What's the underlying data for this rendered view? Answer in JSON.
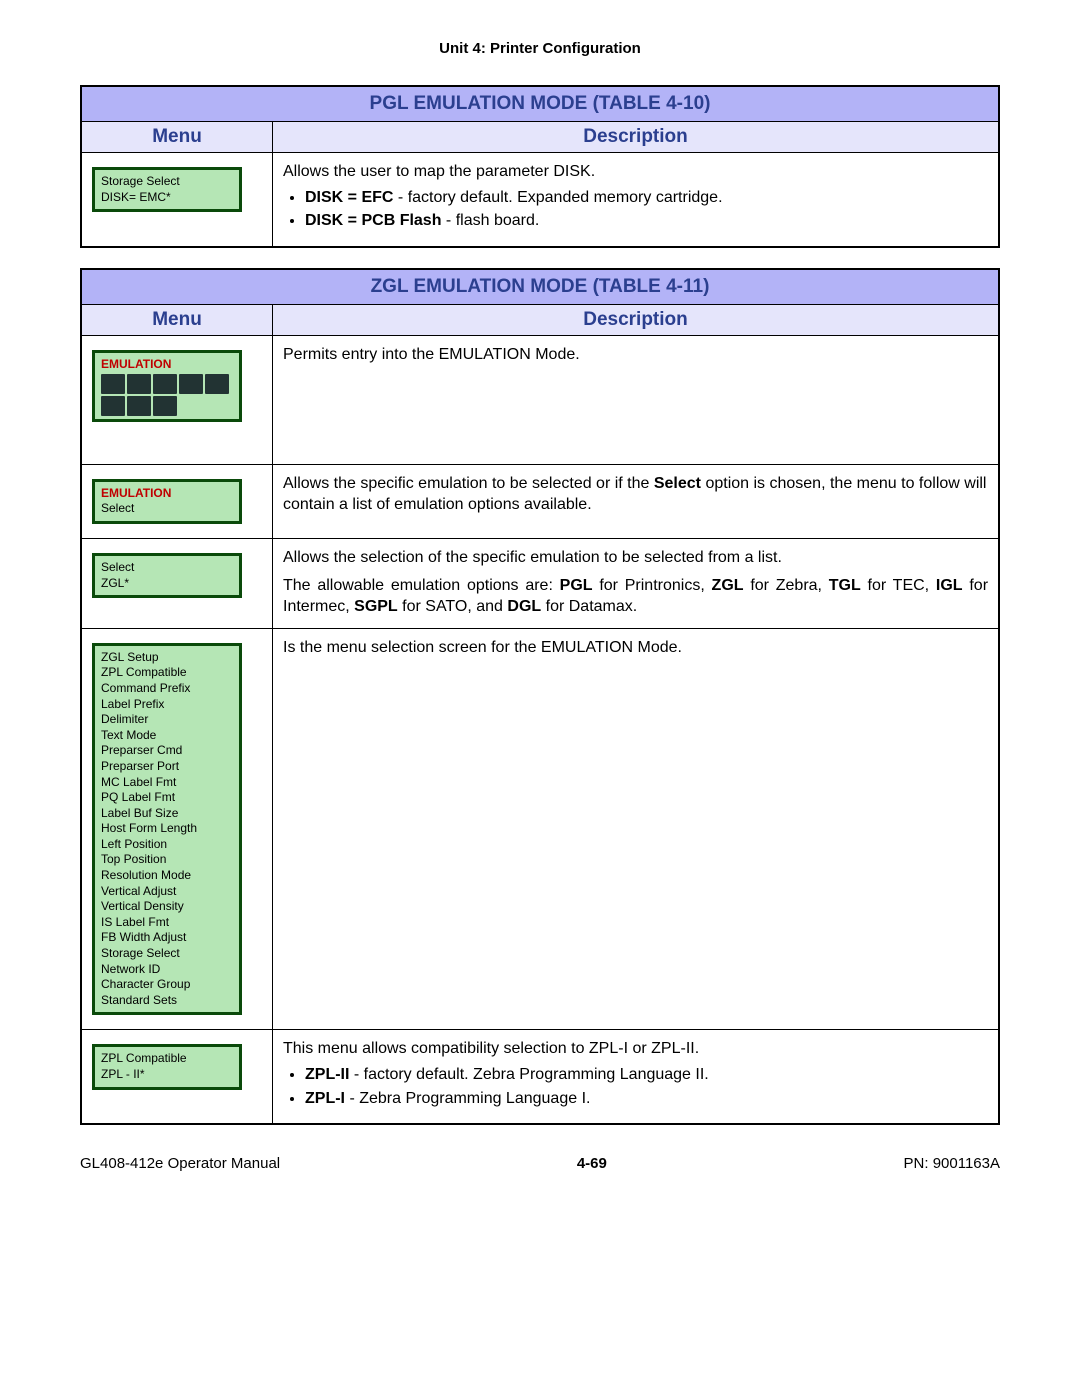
{
  "page_header": "Unit 4:  Printer Configuration",
  "table_pgl": {
    "title": "PGL EMULATION MODE (TABLE 4-10)",
    "col_menu": "Menu",
    "col_desc": "Description",
    "rows": [
      {
        "lcd_lines": [
          "Storage Select",
          "DISK= EMC*"
        ],
        "desc_intro": "Allows the user to map the parameter DISK.",
        "b1_bold": "DISK = EFC",
        "b1_rest": " -  factory default. Expanded memory cartridge.",
        "b2_bold": "DISK = PCB Flash",
        "b2_rest": " - flash board."
      }
    ]
  },
  "table_zgl": {
    "title": "ZGL EMULATION MODE (TABLE 4-11)",
    "col_menu": "Menu",
    "col_desc": "Description",
    "rows": [
      {
        "lcd_title": "EMULATION",
        "lcd_is_icon_grid": true,
        "desc_plain": "Permits entry into the EMULATION Mode."
      },
      {
        "lcd_title": "EMULATION",
        "lcd_lines": [
          "Select"
        ],
        "desc_pre": "Allows the specific emulation to be selected or if the ",
        "desc_bold": "Select",
        "desc_post": " option is chosen, the menu to follow will contain a list of emulation options available."
      },
      {
        "lcd_lines": [
          "Select",
          "ZGL*"
        ],
        "desc_line1": "Allows the selection of the specific emulation to be selected from a list.",
        "desc_line2_pre": "The allowable emulation options are: ",
        "opts": [
          {
            "b": "PGL",
            "t": " for Printronics, "
          },
          {
            "b": "ZGL",
            "t": " for Zebra, "
          },
          {
            "b": "TGL",
            "t": " for TEC, "
          },
          {
            "b": "IGL",
            "t": " for Intermec, "
          },
          {
            "b": "SGPL",
            "t": " for SATO, and "
          },
          {
            "b": "DGL",
            "t": " for Datamax."
          }
        ]
      },
      {
        "lcd_lines": [
          "ZGL Setup",
          "ZPL Compatible",
          "Command Prefix",
          "Label Prefix",
          "Delimiter",
          "Text Mode",
          "Preparser Cmd",
          "Preparser Port",
          "MC Label Fmt",
          "PQ Label Fmt",
          "Label Buf Size",
          "Host Form Length",
          "Left Position",
          "Top Position",
          "Resolution Mode",
          "Vertical Adjust",
          "Vertical Density",
          "IS Label Fmt",
          "FB Width Adjust",
          "Storage Select",
          "Network ID",
          "Character Group",
          "Standard Sets"
        ],
        "desc_plain": "Is the menu selection screen for the EMULATION Mode."
      },
      {
        "lcd_lines": [
          "ZPL Compatible",
          "ZPL - II*"
        ],
        "desc_intro": "This menu allows compatibility selection to ZPL-I or ZPL-II.",
        "b1_bold": "ZPL-II",
        "b1_rest": " - factory default. Zebra Programming Language II.",
        "b2_bold": "ZPL-I ",
        "b2_rest": " - Zebra Programming Language I."
      }
    ]
  },
  "footer": {
    "left": "GL408-412e Operator Manual",
    "center": "4-69",
    "right": "PN: 9001163A"
  }
}
